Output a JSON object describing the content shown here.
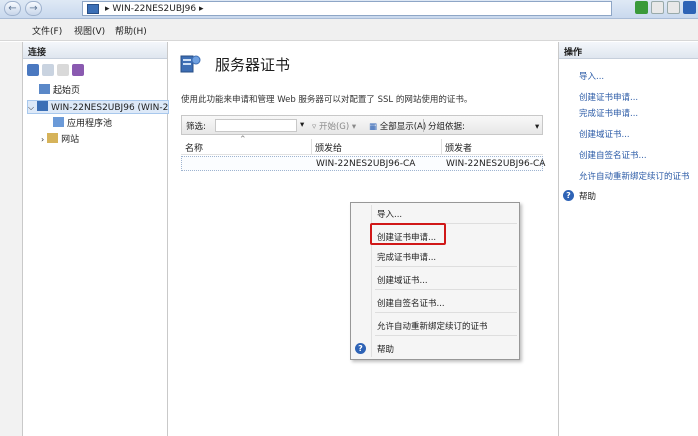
{
  "address": {
    "path": "WIN-22NES2UBJ96",
    "back_glyph": "←",
    "forward_glyph": "→",
    "chevron": "▸"
  },
  "menu": {
    "items": [
      "文件(F)",
      "视图(V)",
      "帮助(H)"
    ]
  },
  "connections": {
    "title": "连接",
    "tree": [
      {
        "label": "起始页"
      },
      {
        "label": "WIN-22NES2UBJ96 (WIN-2"
      },
      {
        "label": "应用程序池"
      },
      {
        "label": "网站"
      }
    ]
  },
  "main": {
    "title": "服务器证书",
    "description": "使用此功能来申请和管理 Web 服务器可以对配置了 SSL 的网站使用的证书。",
    "filter_label": "筛选:",
    "start_label": "开始(G)",
    "show_all_label": "全部显示(A)",
    "group_by_label": "分组依据:",
    "columns": [
      "名称",
      "颁发给",
      "颁发者"
    ],
    "rows": [
      {
        "name": "",
        "issued_to": "WIN-22NES2UBJ96-CA",
        "issued_by": "WIN-22NES2UBJ96-CA"
      }
    ]
  },
  "actions": {
    "title": "操作",
    "items": [
      "导入...",
      "创建证书申请...",
      "完成证书申请...",
      "创建域证书...",
      "创建自签名证书...",
      "允许自动重新绑定续订的证书"
    ],
    "help": "帮助"
  },
  "context_menu": {
    "items": [
      "导入...",
      "创建证书申请...",
      "完成证书申请...",
      "创建域证书...",
      "创建自签名证书...",
      "允许自动重新绑定续订的证书"
    ],
    "help": "帮助"
  },
  "colors": {
    "link": "#2a5aa6",
    "highlight_box": "#d01818",
    "help_icon": "#2e63b6"
  }
}
